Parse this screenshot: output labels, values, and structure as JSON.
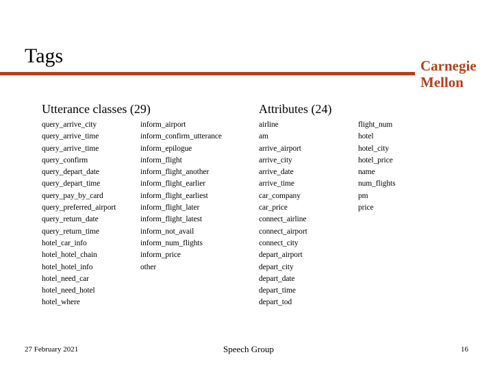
{
  "slide": {
    "title": "Tags",
    "logo_line1": "Carnegie",
    "logo_line2": "Mellon",
    "accent_color": "#b5401a"
  },
  "utterance_classes": {
    "heading": "Utterance classes (29)",
    "column1": [
      "query_arrive_city",
      "query_arrive_time",
      "query_arrive_time",
      "query_confirm",
      "query_depart_date",
      "query_depart_time",
      "query_pay_by_card",
      "query_preferred_airport",
      "query_return_date",
      "query_return_time",
      "hotel_car_info",
      "hotel_hotel_chain",
      "hotel_hotel_info",
      "hotel_need_car",
      "hotel_need_hotel",
      "hotel_where"
    ],
    "column2": [
      "inform_airport",
      "inform_confirm_utterance",
      "inform_epilogue",
      "inform_flight",
      "inform_flight_another",
      "inform_flight_earlier",
      "inform_flight_earliest",
      "inform_flight_later",
      "inform_flight_latest",
      "inform_not_avail",
      "inform_num_flights",
      "inform_price",
      "other"
    ]
  },
  "attributes": {
    "heading": "Attributes (24)",
    "column1": [
      "airline",
      "am",
      "arrive_airport",
      "arrive_city",
      "arrive_date",
      "arrive_time",
      "car_company",
      "car_price",
      "connect_airline",
      "connect_airport",
      "connect_city",
      "depart_airport",
      "depart_city",
      "depart_date",
      "depart_time",
      "depart_tod"
    ],
    "column2": [
      "flight_num",
      "hotel",
      "hotel_city",
      "hotel_price",
      "name",
      "num_flights",
      "pm",
      "price"
    ]
  },
  "footer": {
    "date": "27 February 2021",
    "center": "Speech Group",
    "page_number": "16"
  }
}
